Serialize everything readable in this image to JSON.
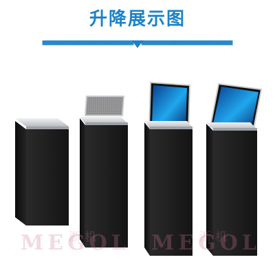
{
  "header": {
    "title": "升降展示图"
  },
  "watermark": {
    "latin": "MEGOL",
    "cjk": "浙机"
  },
  "colors": {
    "title_blue": "#1b83c6",
    "banner_blue": "#1e7fc3",
    "body_black": "#1f1f1f",
    "trim_silver": "#cfd2d6"
  },
  "products": [
    {
      "state": "closed",
      "screen": "none"
    },
    {
      "state": "half-raised",
      "screen": "grey mesh"
    },
    {
      "state": "raised",
      "screen": "blue display"
    },
    {
      "state": "fully-raised",
      "screen": "blue display"
    }
  ]
}
